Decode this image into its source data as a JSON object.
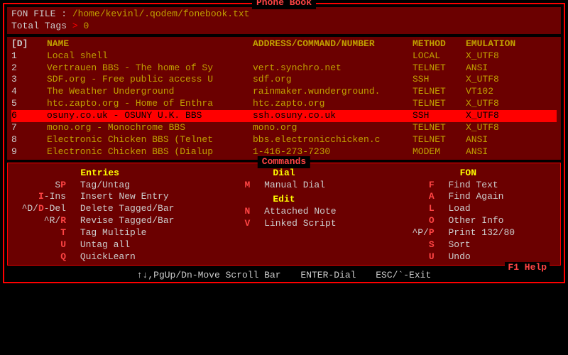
{
  "title": "Phone Book",
  "fon_file_label": "FON FILE :",
  "fon_file_value": "/home/kevinl/.qodem/fonebook.txt",
  "total_tags_label": "Total Tags",
  "total_tags_sep": ">",
  "total_tags_value": "0",
  "columns": {
    "idx": "[D]",
    "name": "NAME",
    "addr": "ADDRESS/COMMAND/NUMBER",
    "method": "METHOD",
    "emul": "EMULATION"
  },
  "entries": [
    {
      "n": "1",
      "name": "Local shell",
      "addr": "",
      "method": "LOCAL",
      "emul": "X_UTF8",
      "sel": false
    },
    {
      "n": "2",
      "name": "Vertrauen BBS - The home of Sy",
      "addr": "vert.synchro.net",
      "method": "TELNET",
      "emul": "ANSI",
      "sel": false
    },
    {
      "n": "3",
      "name": "SDF.org - Free public access U",
      "addr": "sdf.org",
      "method": "SSH",
      "emul": "X_UTF8",
      "sel": false
    },
    {
      "n": "4",
      "name": "The Weather Underground",
      "addr": "rainmaker.wunderground.",
      "method": "TELNET",
      "emul": "VT102",
      "sel": false
    },
    {
      "n": "5",
      "name": "htc.zapto.org - Home of Enthra",
      "addr": "htc.zapto.org",
      "method": "TELNET",
      "emul": "X_UTF8",
      "sel": false
    },
    {
      "n": "6",
      "name": "osuny.co.uk - OSUNY U.K. BBS",
      "addr": "ssh.osuny.co.uk",
      "method": "SSH",
      "emul": "X_UTF8",
      "sel": true
    },
    {
      "n": "7",
      "name": "mono.org - Monochrome BBS",
      "addr": "mono.org",
      "method": "TELNET",
      "emul": "X_UTF8",
      "sel": false
    },
    {
      "n": "8",
      "name": "Electronic Chicken BBS (Telnet",
      "addr": "bbs.electronicchicken.c",
      "method": "TELNET",
      "emul": "ANSI",
      "sel": false
    },
    {
      "n": "9",
      "name": "Electronic Chicken BBS (Dialup",
      "addr": "1-416-273-7230",
      "method": "MODEM",
      "emul": "ANSI",
      "sel": false
    }
  ],
  "commands_title": "Commands",
  "cmd_sections": {
    "entries": "Entries",
    "dial": "Dial",
    "edit": "Edit",
    "fon": "FON"
  },
  "cmds": {
    "sp": {
      "key_pre": "S",
      "key_hot": "P",
      "key_post": "",
      "label": "Tag/Untag"
    },
    "ins": {
      "key_pre": "",
      "key_hot": "I",
      "key_post": "-Ins",
      "label": "Insert New Entry"
    },
    "del": {
      "key_pre": "^D/",
      "key_hot": "D",
      "key_post": "-Del",
      "label": "Delete Tagged/Bar"
    },
    "rev": {
      "key_pre": "^R/",
      "key_hot": "R",
      "key_post": "",
      "label": "Revise Tagged/Bar"
    },
    "tag": {
      "key_pre": "",
      "key_hot": "T",
      "key_post": "",
      "label": "Tag Multiple"
    },
    "untag": {
      "key_pre": "",
      "key_hot": "U",
      "key_post": "",
      "label": "Untag all"
    },
    "quick": {
      "key_pre": "",
      "key_hot": "Q",
      "key_post": "",
      "label": "QuickLearn"
    },
    "manual": {
      "key_pre": "",
      "key_hot": "M",
      "key_post": "",
      "label": "Manual Dial"
    },
    "note": {
      "key_pre": "",
      "key_hot": "N",
      "key_post": "",
      "label": "Attached Note"
    },
    "script": {
      "key_pre": "",
      "key_hot": "V",
      "key_post": "",
      "label": "Linked Script"
    },
    "find": {
      "key_pre": "",
      "key_hot": "F",
      "key_post": "",
      "label": "Find Text"
    },
    "again": {
      "key_pre": "",
      "key_hot": "A",
      "key_post": "",
      "label": "Find Again"
    },
    "load": {
      "key_pre": "",
      "key_hot": "L",
      "key_post": "",
      "label": "Load"
    },
    "other": {
      "key_pre": "",
      "key_hot": "O",
      "key_post": "",
      "label": "Other Info"
    },
    "print": {
      "key_pre": "^P/",
      "key_hot": "P",
      "key_post": "",
      "label": "Print 132/80"
    },
    "sort": {
      "key_pre": "",
      "key_hot": "S",
      "key_post": "",
      "label": "Sort"
    },
    "undo": {
      "key_pre": "",
      "key_hot": "U",
      "key_post": "",
      "label": "Undo"
    }
  },
  "f1": "F1 Help",
  "footer": {
    "move": "↑↓,PgUp/Dn-Move Scroll Bar",
    "dial": "ENTER-Dial",
    "exit": "ESC/`-Exit"
  }
}
